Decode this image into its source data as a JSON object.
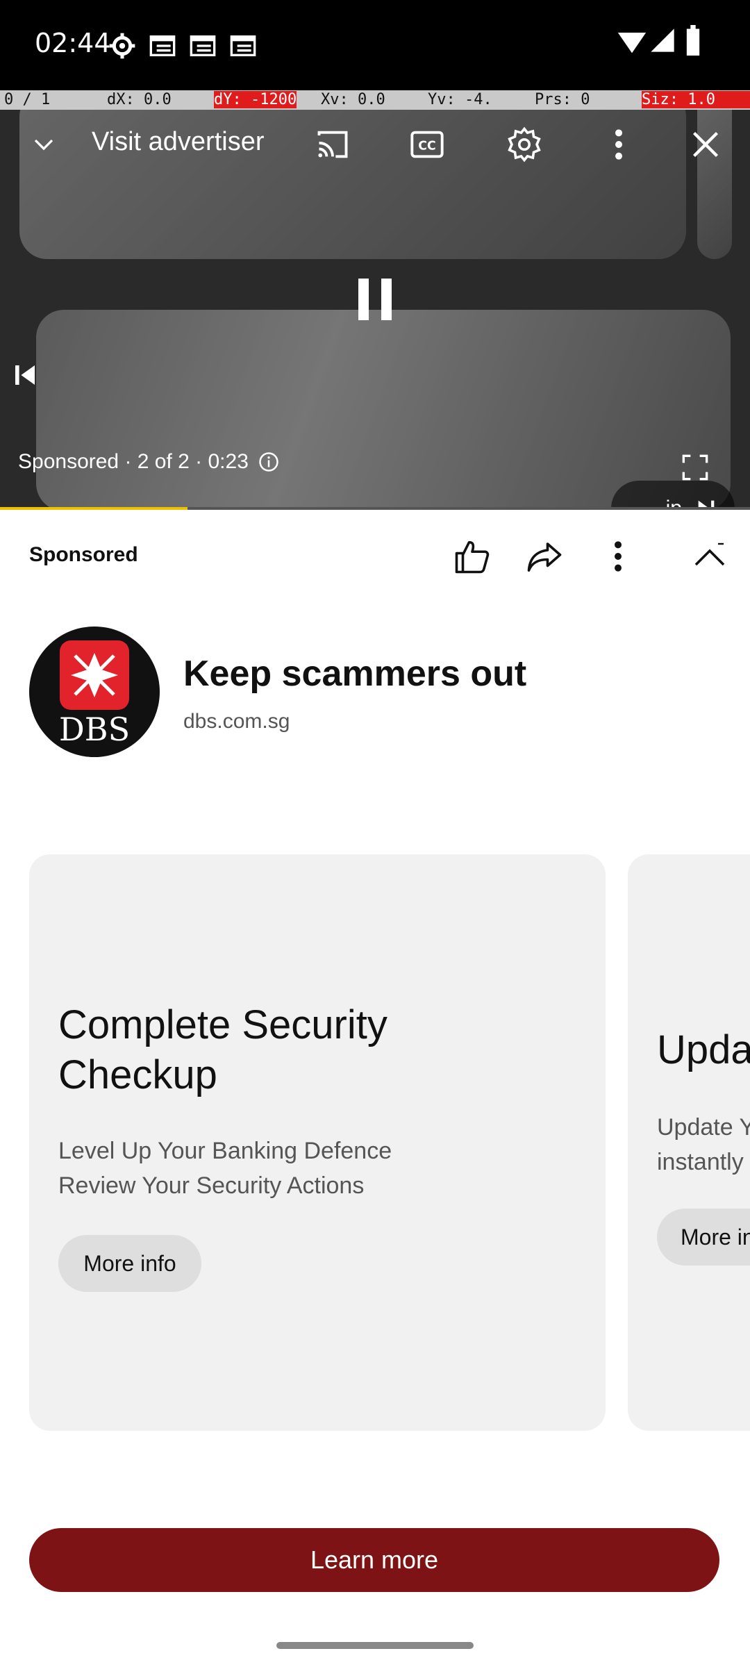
{
  "status_bar": {
    "time": "02:44",
    "icons": [
      "settings-gear-icon",
      "screen-cast-icon",
      "screen-cast-icon",
      "screen-cast-icon"
    ],
    "right_icons": [
      "wifi-icon",
      "signal-icon",
      "battery-icon"
    ]
  },
  "debug_bar": {
    "pointer": "0 / 1",
    "dx": "dX: 0.0",
    "dy": "dY: -1200",
    "xv": "Xv: 0.0",
    "yv": "Yv: -4.",
    "prs": "Prs: 0",
    "size": "Siz: 1.0"
  },
  "player": {
    "visit_advertiser": "Visit advertiser",
    "sponsored_line": "Sponsored · 2 of 2 · 0:23",
    "skip_label": "ip",
    "progress_fraction": 0.25,
    "accent_progress": "#f0c000"
  },
  "ad": {
    "label": "Sponsored",
    "brand_logo_text": "DBS",
    "title": "Keep scammers out",
    "url": "dbs.com.sg"
  },
  "cards": [
    {
      "title_line1": "Complete Security",
      "title_line2": "Checkup",
      "line1": "Level Up Your Banking Defence",
      "line2": "Review Your Security Actions",
      "button": "More info"
    },
    {
      "title_line1": "Upda",
      "line1": "Update Y",
      "line2": "instantly",
      "button": "More in"
    }
  ],
  "cta": {
    "label": "Learn more",
    "color": "#7d1315"
  }
}
